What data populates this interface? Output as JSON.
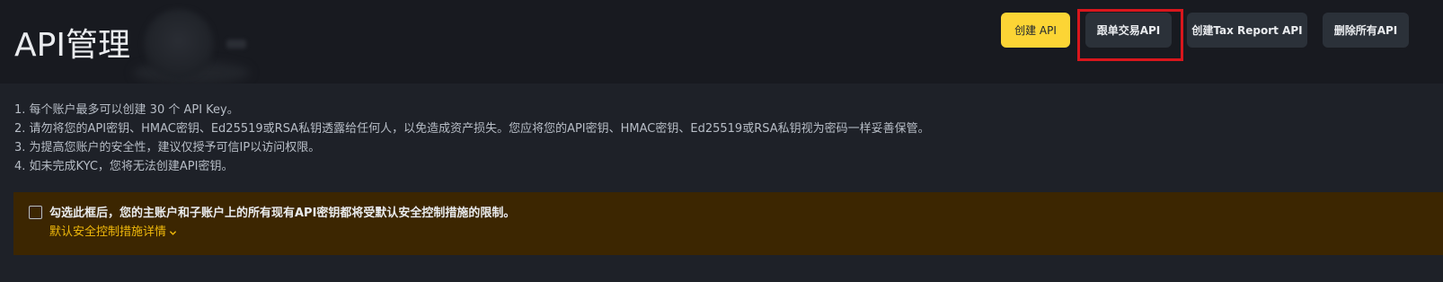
{
  "header": {
    "title": "API管理",
    "buttons": {
      "create": "创建 API",
      "copy_trading": "跟单交易API",
      "tax_report": "创建Tax Report API",
      "delete_all": "删除所有API"
    }
  },
  "notes": [
    "1. 每个账户最多可以创建 30 个 API Key。",
    "2. 请勿将您的API密钥、HMAC密钥、Ed25519或RSA私钥透露给任何人，以免造成资产损失。您应将您的API密钥、HMAC密钥、Ed25519或RSA私钥视为密码一样妥善保管。",
    "3. 为提高您账户的安全性，建议仅授予可信IP以访问权限。",
    "4. 如未完成KYC，您将无法创建API密钥。"
  ],
  "warning": {
    "text": "勾选此框后，您的主账户和子账户上的所有现有API密钥都将受默认安全控制措施的限制。",
    "link": "默认安全控制措施详情"
  },
  "colors": {
    "accent": "#fcd535",
    "link": "#f0b90b",
    "highlight": "#d9161c",
    "warning_bg": "#3c2601"
  },
  "icons": [
    "chevron-down-icon"
  ]
}
